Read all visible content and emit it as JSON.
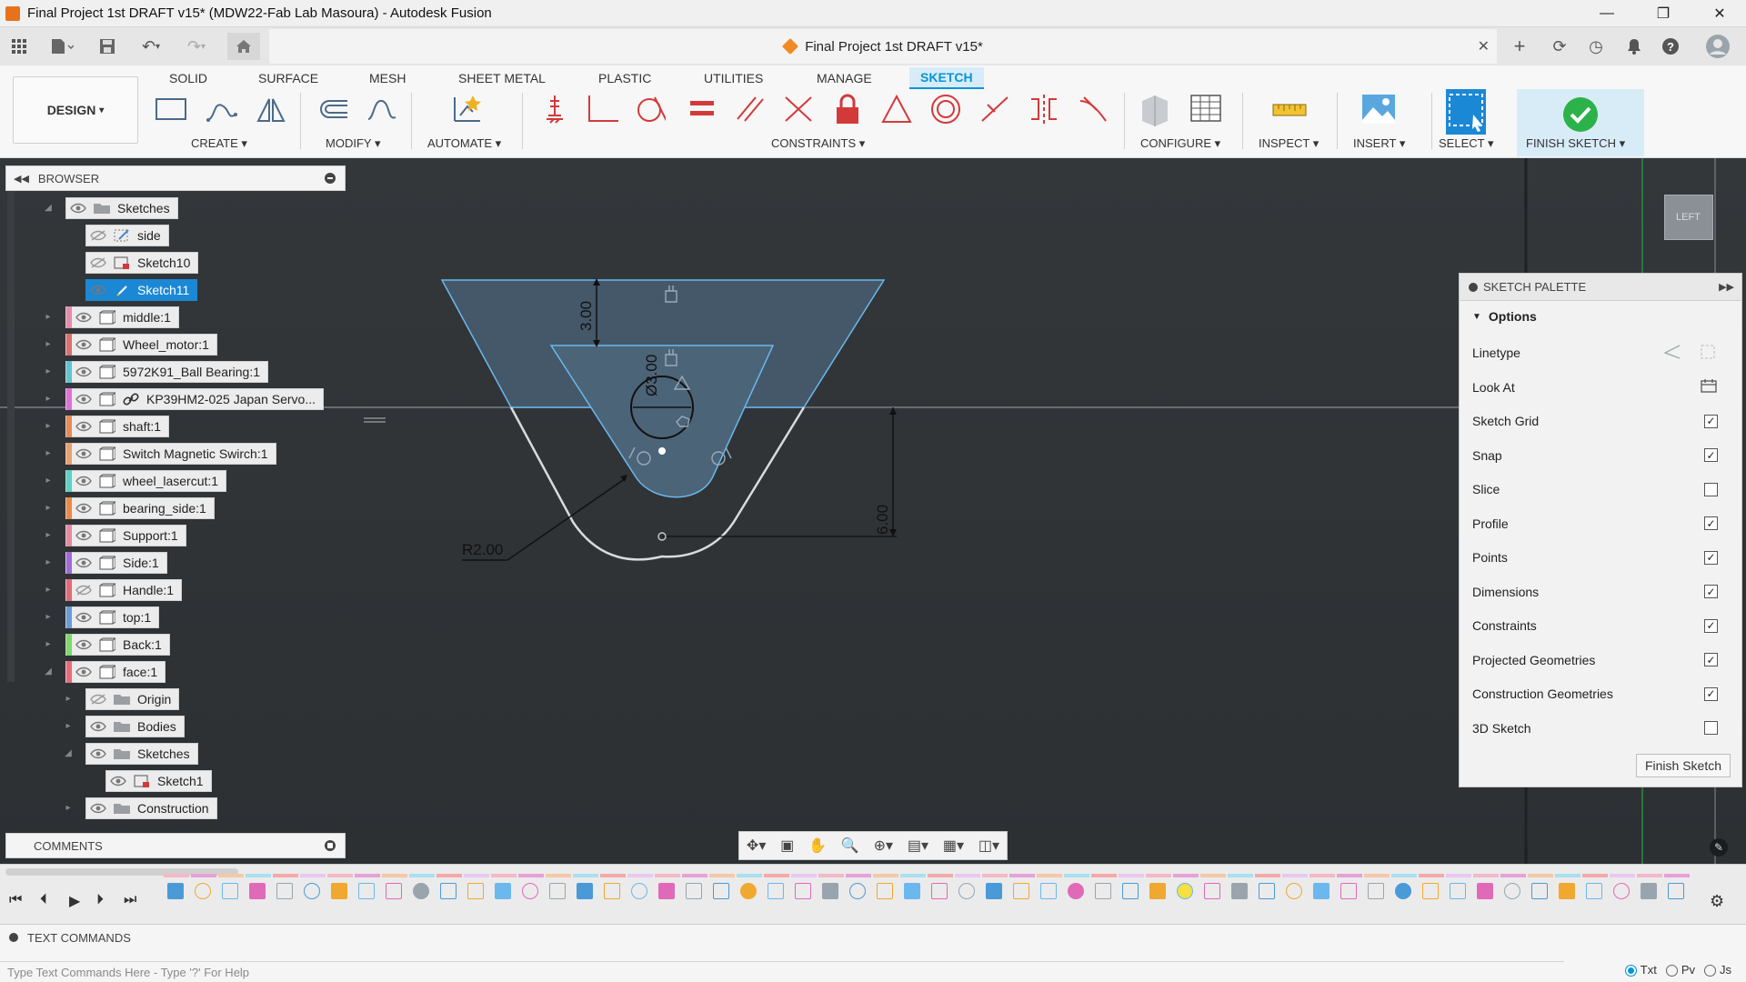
{
  "window": {
    "title": "Final Project 1st DRAFT v15* (MDW22-Fab Lab Masoura) - Autodesk Fusion",
    "controls": [
      "minimize",
      "maximize",
      "close"
    ]
  },
  "document_tab": {
    "label": "Final Project 1st DRAFT v15*"
  },
  "toolbar": {
    "workspace_button": "DESIGN",
    "workspace_tabs": [
      "SOLID",
      "SURFACE",
      "MESH",
      "SHEET METAL",
      "PLASTIC",
      "UTILITIES",
      "MANAGE",
      "SKETCH"
    ],
    "active_tab": "SKETCH",
    "groups": {
      "create": "CREATE",
      "modify": "MODIFY",
      "automate": "AUTOMATE",
      "constraints": "CONSTRAINTS",
      "configure": "CONFIGURE",
      "inspect": "INSPECT",
      "insert": "INSERT",
      "select": "SELECT",
      "finish_sketch": "FINISH SKETCH"
    }
  },
  "browser": {
    "header": "BROWSER",
    "nodes": [
      {
        "label": "Sketches",
        "color": "",
        "selected": false
      },
      {
        "label": "side",
        "color": "",
        "selected": false
      },
      {
        "label": "Sketch10",
        "color": "",
        "selected": false
      },
      {
        "label": "Sketch11",
        "color": "",
        "selected": true
      },
      {
        "label": "middle:1",
        "color": "#e88aa8",
        "selected": false
      },
      {
        "label": "Wheel_motor:1",
        "color": "#d87070",
        "selected": false
      },
      {
        "label": "5972K91_Ball Bearing:1",
        "color": "#5fc4d0",
        "selected": false
      },
      {
        "label": "KP39HM2-025 Japan Servo...",
        "color": "#e070d8",
        "selected": false
      },
      {
        "label": "shaft:1",
        "color": "#e58a58",
        "selected": false
      },
      {
        "label": "Switch Magnetic Swirch:1",
        "color": "#e8a070",
        "selected": false
      },
      {
        "label": "wheel_lasercut:1",
        "color": "#5ad2c4",
        "selected": false
      },
      {
        "label": "bearing_side:1",
        "color": "#e88a46",
        "selected": false
      },
      {
        "label": "Support:1",
        "color": "#e58aa0",
        "selected": false
      },
      {
        "label": "Side:1",
        "color": "#a06ad8",
        "selected": false
      },
      {
        "label": "Handle:1",
        "color": "#e06a7a",
        "selected": false
      },
      {
        "label": "top:1",
        "color": "#6a9ad8",
        "selected": false
      },
      {
        "label": "Back:1",
        "color": "#7ed86a",
        "selected": false
      },
      {
        "label": "face:1",
        "color": "#e86a7a",
        "selected": false
      },
      {
        "label": "Origin",
        "color": "",
        "selected": false
      },
      {
        "label": "Bodies",
        "color": "",
        "selected": false
      },
      {
        "label": "Sketches",
        "color": "",
        "selected": false
      },
      {
        "label": "Sketch1",
        "color": "",
        "selected": false
      },
      {
        "label": "Construction",
        "color": "",
        "selected": false
      }
    ]
  },
  "sketch": {
    "dimensions": [
      "3.00",
      "Ø3.00",
      "6.00",
      "R2.00"
    ]
  },
  "viewcube": {
    "label": "LEFT"
  },
  "palette": {
    "title": "SKETCH PALETTE",
    "section": "Options",
    "rows": [
      {
        "label": "Linetype",
        "kind": "icons"
      },
      {
        "label": "Look At",
        "kind": "icon"
      },
      {
        "label": "Sketch Grid",
        "checked": true
      },
      {
        "label": "Snap",
        "checked": true
      },
      {
        "label": "Slice",
        "checked": false
      },
      {
        "label": "Profile",
        "checked": true
      },
      {
        "label": "Points",
        "checked": true
      },
      {
        "label": "Dimensions",
        "checked": true
      },
      {
        "label": "Constraints",
        "checked": true
      },
      {
        "label": "Projected Geometries",
        "checked": true
      },
      {
        "label": "Construction Geometries",
        "checked": true
      },
      {
        "label": "3D Sketch",
        "checked": false
      }
    ],
    "finish_button": "Finish Sketch"
  },
  "comments": {
    "header": "COMMENTS"
  },
  "text_commands": {
    "header": "TEXT COMMANDS",
    "placeholder": "Type Text Commands Here - Type '?' For Help",
    "modes": [
      "Txt",
      "Pv",
      "Js"
    ],
    "selected_mode": "Txt"
  },
  "colors": {
    "accent": "#0696d7",
    "selected_node": "#1b88d6",
    "canvas": "#2d3134",
    "sketch_line": "#5fb0e8"
  }
}
